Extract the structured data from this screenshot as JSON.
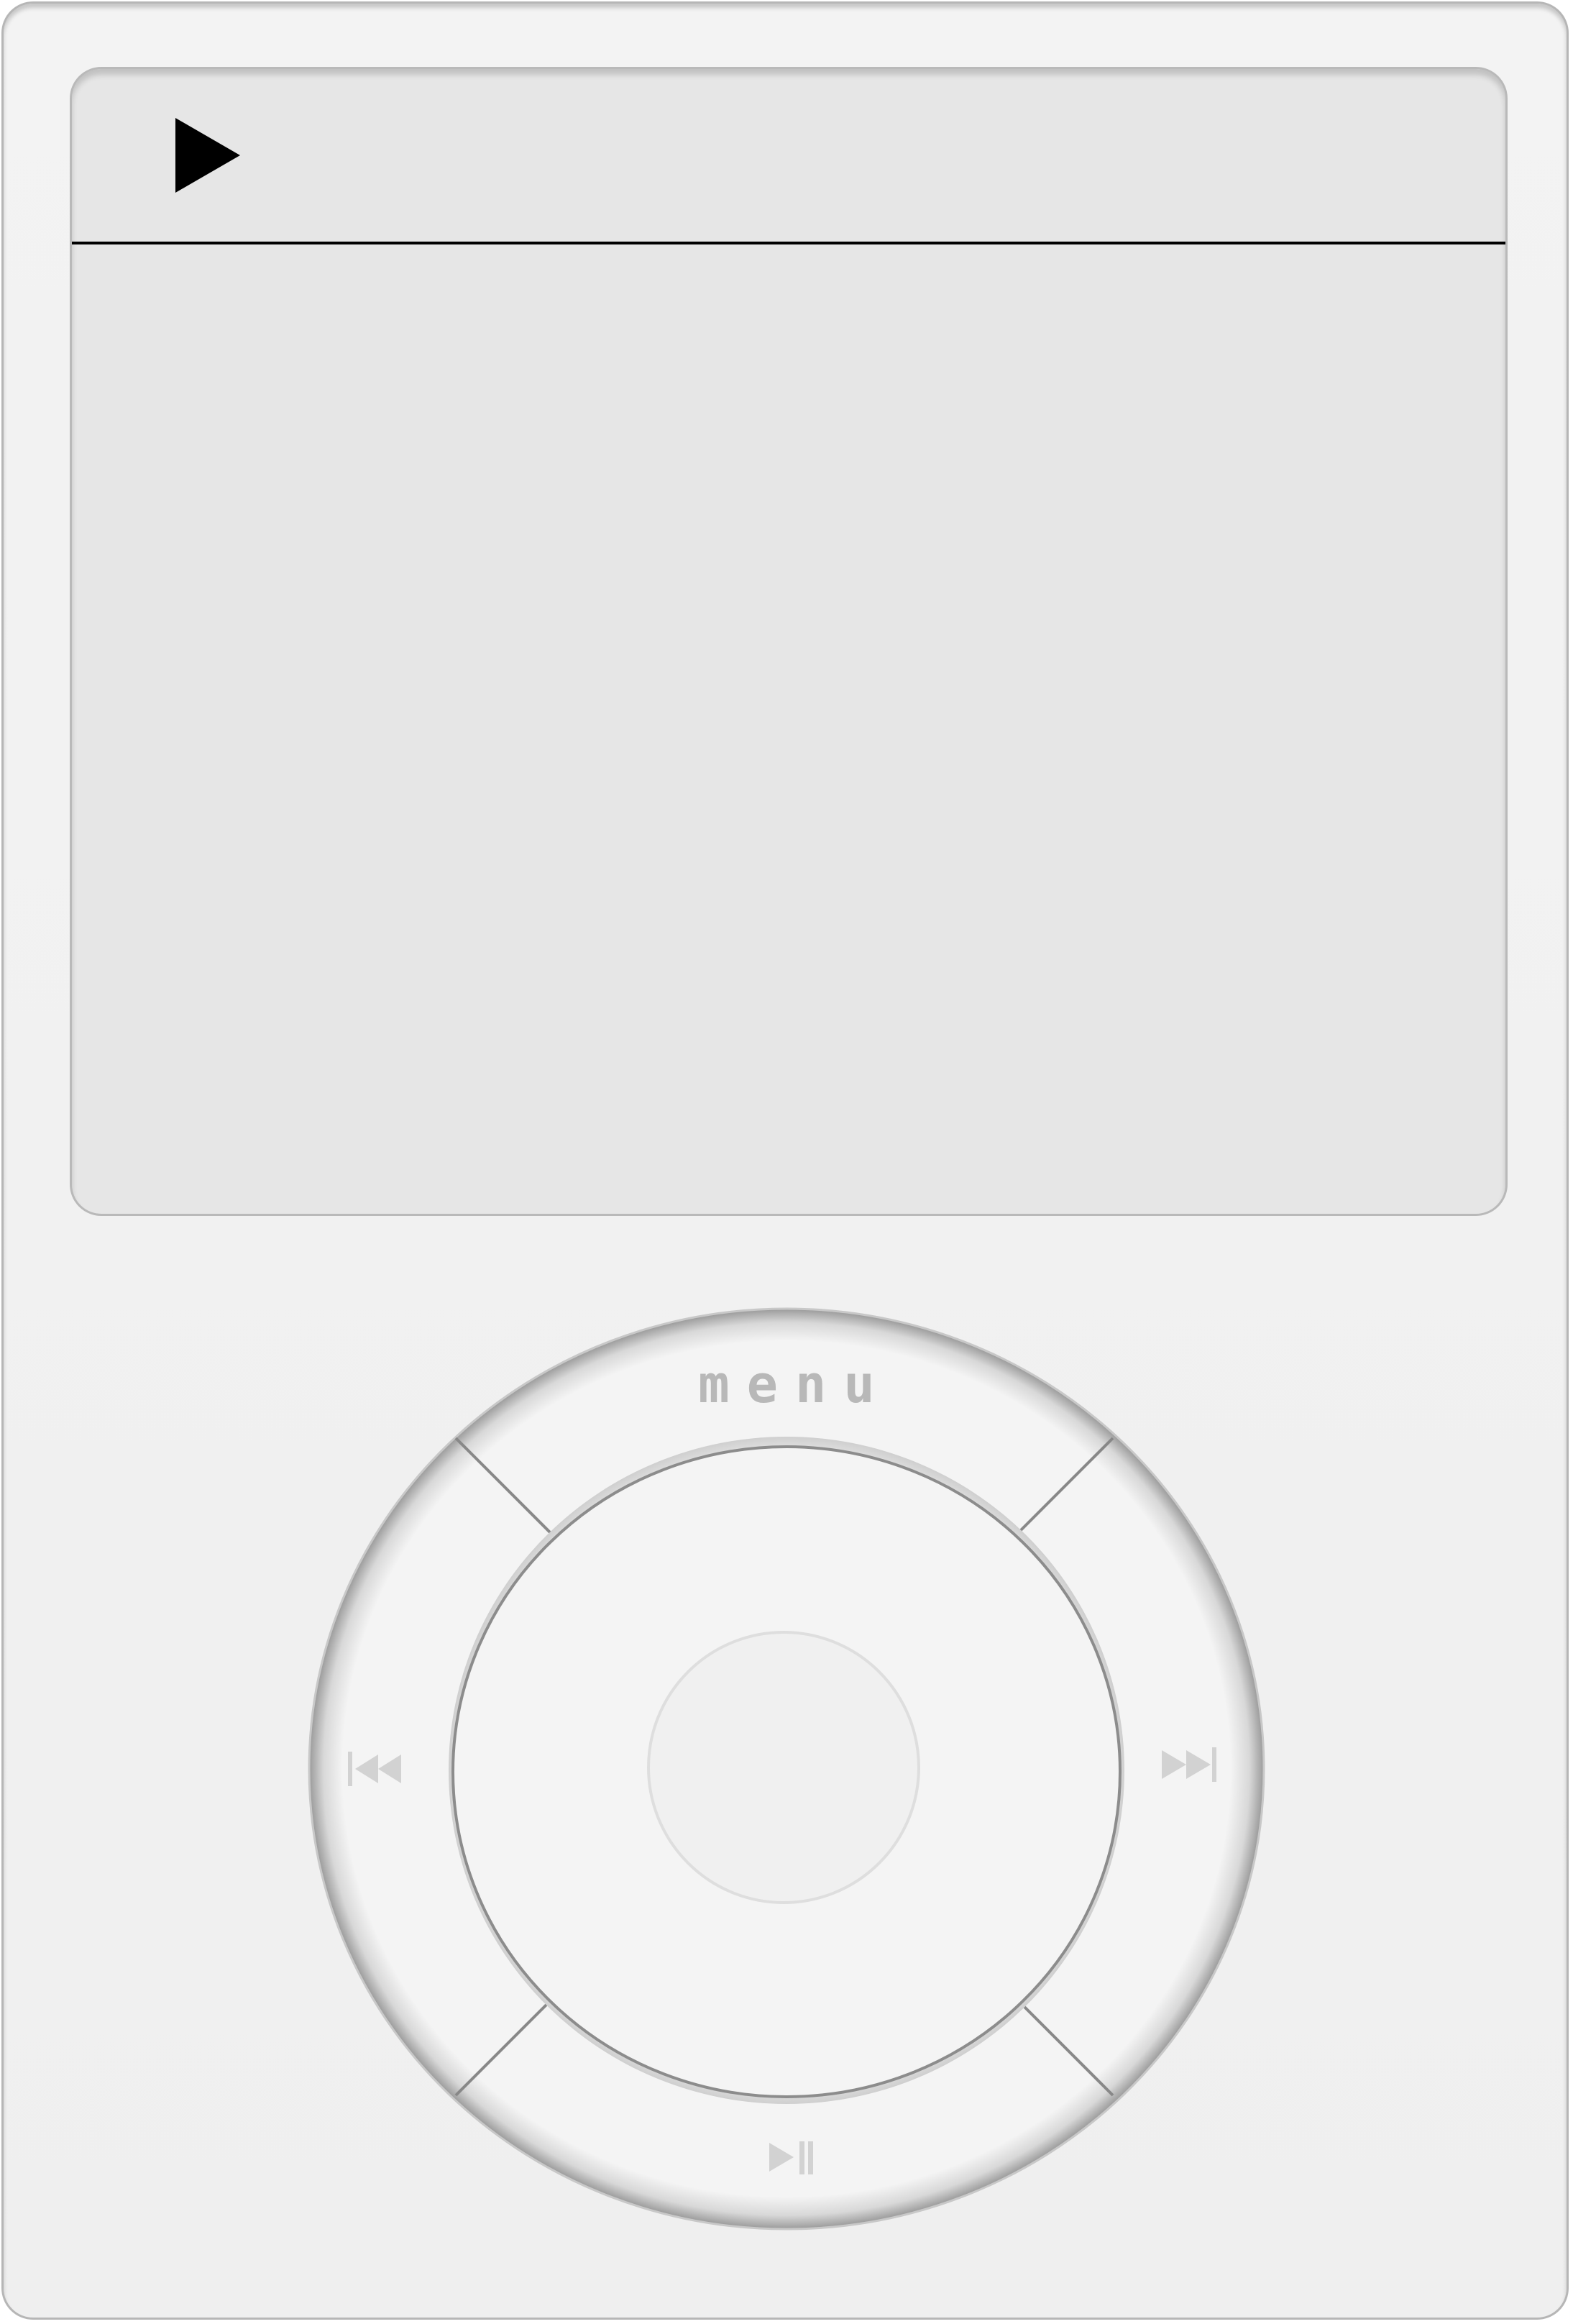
{
  "screen": {
    "status_icon": "play-icon",
    "content": ""
  },
  "click_wheel": {
    "top_label": "menu",
    "left_icon": "previous-track-icon",
    "right_icon": "next-track-icon",
    "bottom_icon": "play-pause-icon"
  },
  "colors": {
    "device_body": "#f1f1f1",
    "screen_bg": "#e6e6e6",
    "wheel_fill": "#f4f4f4",
    "label_gray": "#b8b8b8",
    "icon_gray": "#d0d0d0",
    "divider": "#000000"
  }
}
